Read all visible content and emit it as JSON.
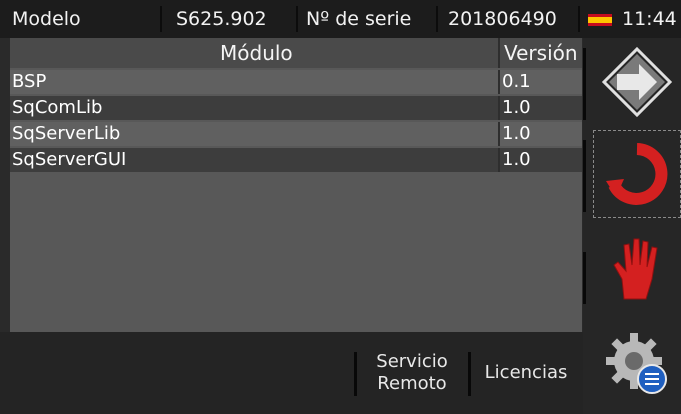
{
  "topbar": {
    "model_label": "Modelo",
    "model_value": "S625.902",
    "serial_label": "Nº de serie",
    "serial_value": "201806490",
    "time": "11:44",
    "flag_icon": "spain-flag-icon"
  },
  "table": {
    "headers": {
      "module": "Módulo",
      "version": "Versión"
    },
    "rows": [
      {
        "module": "BSP",
        "version": "0.1"
      },
      {
        "module": "SqComLib",
        "version": "1.0"
      },
      {
        "module": "SqServerLib",
        "version": "1.0"
      },
      {
        "module": "SqServerGUI",
        "version": "1.0"
      }
    ]
  },
  "bottombar": {
    "remote_service_line1": "Servicio",
    "remote_service_line2": "Remoto",
    "licenses": "Licencias"
  },
  "sidebar": {
    "buttons": [
      {
        "icon": "forward-arrow-icon"
      },
      {
        "icon": "refresh-circle-icon",
        "selected": true
      },
      {
        "icon": "stop-hand-icon"
      },
      {
        "icon": "settings-gear-list-icon"
      }
    ]
  },
  "colors": {
    "red_accent": "#d42020",
    "background": "#2a2a2a",
    "table_background": "#585858"
  }
}
